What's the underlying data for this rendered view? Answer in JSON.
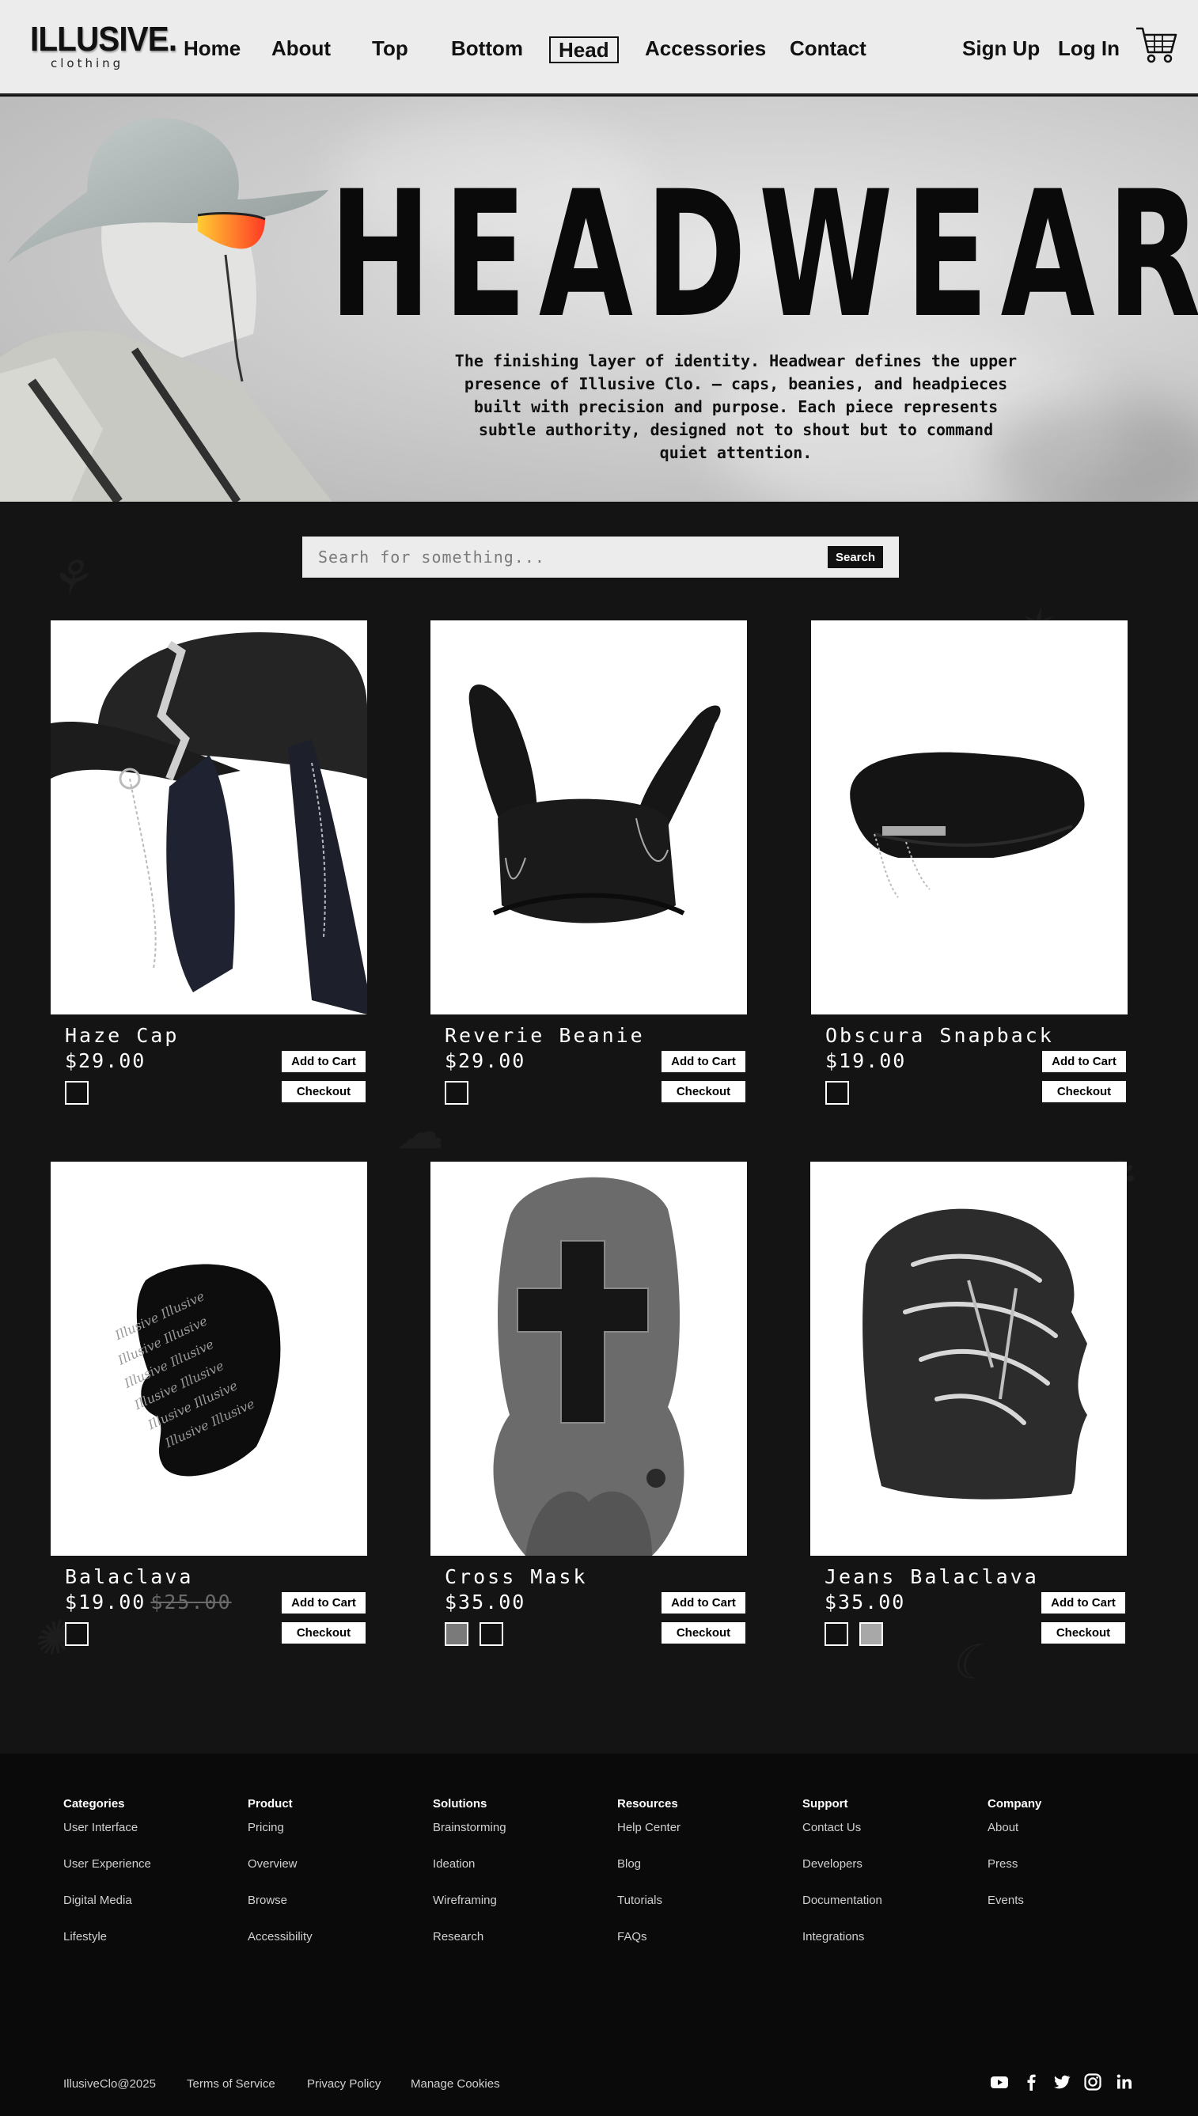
{
  "nav": {
    "logo_main": "ILLUSIVE.",
    "logo_sub": "clothing",
    "links": [
      "Home",
      "About",
      "Top",
      "Bottom",
      "Head",
      "Accessories",
      "Contact"
    ],
    "active": "Head",
    "sign_up": "Sign Up",
    "log_in": "Log In",
    "cart_icon": "shopping-cart-icon"
  },
  "hero": {
    "title": "HEADWEAR",
    "description": "The finishing layer of identity. Headwear defines the upper presence of Illusive Clo. — caps, beanies, and headpieces built with precision and purpose. Each piece represents subtle authority, designed not to shout but to command quiet attention."
  },
  "search": {
    "placeholder": "Searh for something...",
    "button": "Search"
  },
  "products": [
    {
      "name": "Haze Cap",
      "price": "$29.00",
      "old_price": "",
      "add_to_cart": "Add to Cart",
      "checkout": "Checkout",
      "swatches": [
        "#111111"
      ]
    },
    {
      "name": "Reverie Beanie",
      "price": "$29.00",
      "old_price": "",
      "add_to_cart": "Add to Cart",
      "checkout": "Checkout",
      "swatches": [
        "#111111"
      ]
    },
    {
      "name": "Obscura Snapback",
      "price": "$19.00",
      "old_price": "",
      "add_to_cart": "Add to Cart",
      "checkout": "Checkout",
      "swatches": [
        "#111111"
      ]
    },
    {
      "name": "Balaclava",
      "price": "$19.00",
      "old_price": "$25.00",
      "add_to_cart": "Add to Cart",
      "checkout": "Checkout",
      "swatches": [
        "#111111"
      ]
    },
    {
      "name": "Cross Mask",
      "price": "$35.00",
      "old_price": "",
      "add_to_cart": "Add to Cart",
      "checkout": "Checkout",
      "swatches": [
        "#7a7a7a",
        "#111111"
      ]
    },
    {
      "name": "Jeans Balaclava",
      "price": "$35.00",
      "old_price": "",
      "add_to_cart": "Add to Cart",
      "checkout": "Checkout",
      "swatches": [
        "#111111",
        "#a8a8a8"
      ]
    }
  ],
  "footer": {
    "columns": [
      {
        "heading": "Categories",
        "links": [
          "User Interface",
          "User Experience",
          "Digital Media",
          "Lifestyle"
        ]
      },
      {
        "heading": "Product",
        "links": [
          "Pricing",
          "Overview",
          "Browse",
          "Accessibility"
        ]
      },
      {
        "heading": "Solutions",
        "links": [
          "Brainstorming",
          "Ideation",
          "Wireframing",
          "Research"
        ]
      },
      {
        "heading": "Resources",
        "links": [
          "Help Center",
          "Blog",
          "Tutorials",
          "FAQs"
        ]
      },
      {
        "heading": "Support",
        "links": [
          "Contact Us",
          "Developers",
          "Documentation",
          "Integrations"
        ]
      },
      {
        "heading": "Company",
        "links": [
          "About",
          "Press",
          "Events"
        ]
      }
    ],
    "copyright": "IllusiveClo@2025",
    "terms": "Terms of Service",
    "privacy": "Privacy Policy",
    "cookies": "Manage Cookies",
    "social_icons": [
      "youtube-icon",
      "facebook-icon",
      "twitter-icon",
      "instagram-icon",
      "linkedin-icon"
    ]
  }
}
